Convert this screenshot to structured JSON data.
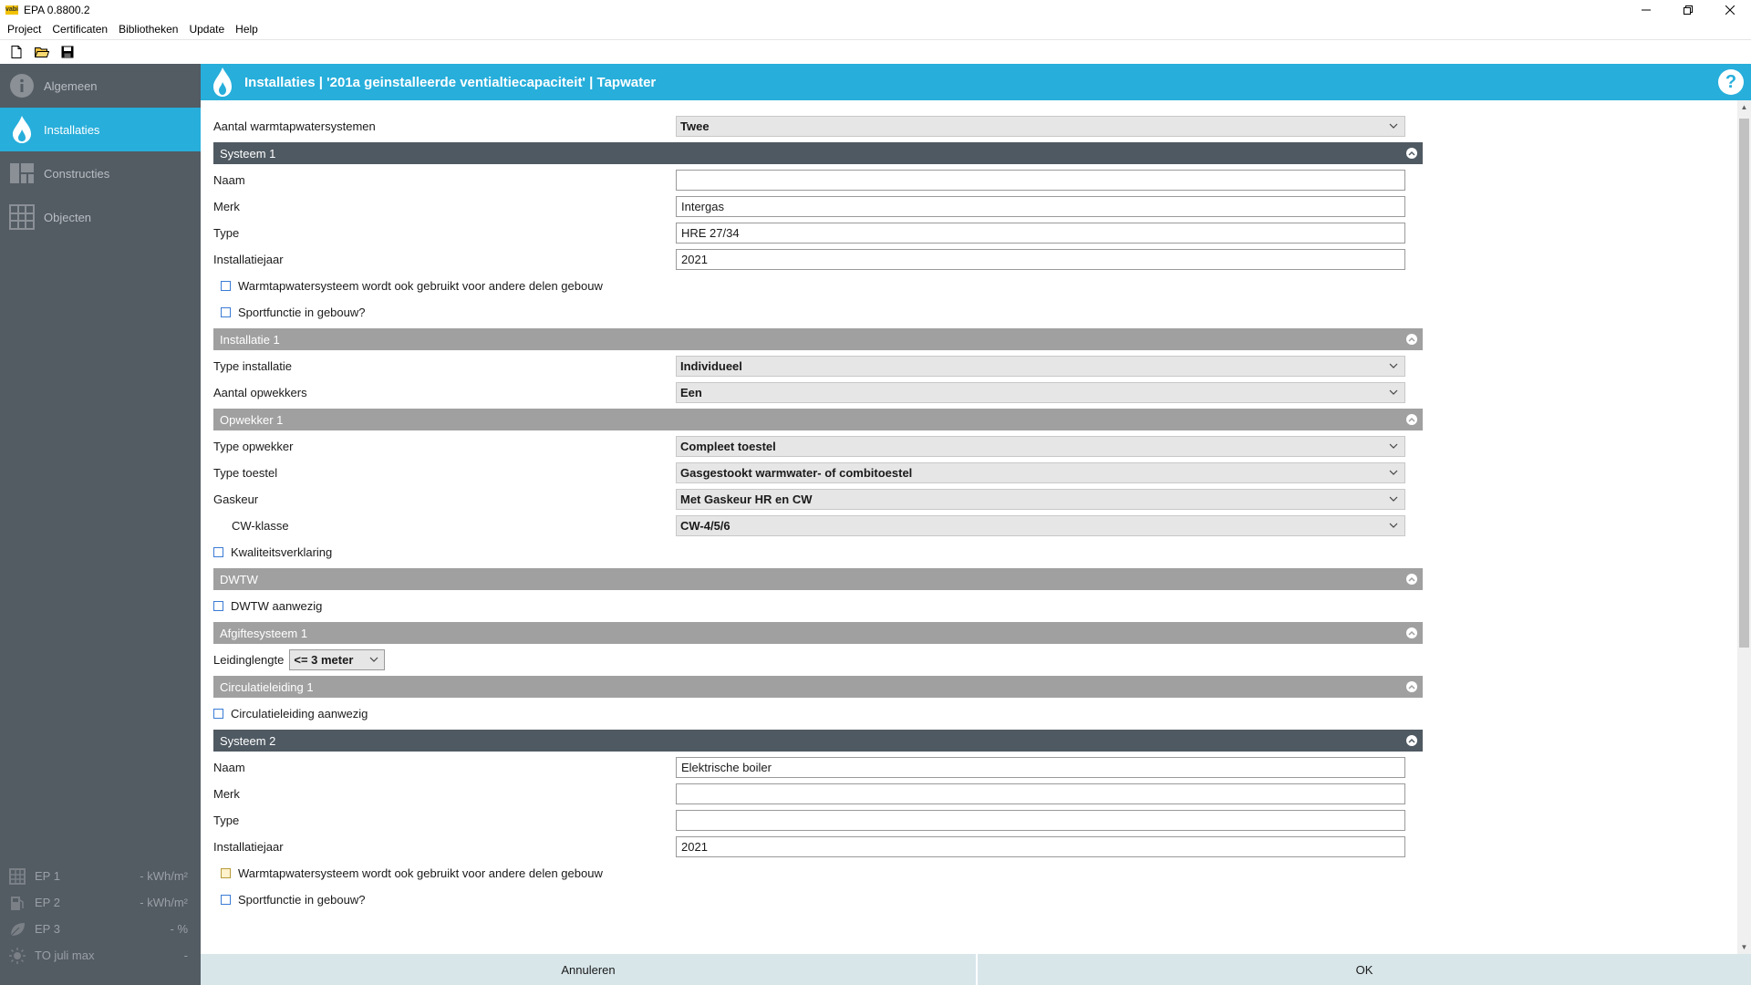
{
  "window": {
    "title": "EPA 0.8800.2",
    "app_badge": "vabi"
  },
  "menu": [
    "Project",
    "Certificaten",
    "Bibliotheken",
    "Update",
    "Help"
  ],
  "sidebar": {
    "items": [
      {
        "label": "Algemeen",
        "icon": "info-icon"
      },
      {
        "label": "Installaties",
        "icon": "flame-icon",
        "active": true
      },
      {
        "label": "Constructies",
        "icon": "blocks-icon"
      },
      {
        "label": "Objecten",
        "icon": "building-icon"
      }
    ],
    "stats": [
      {
        "label": "EP 1",
        "value": "- kWh/m²"
      },
      {
        "label": "EP 2",
        "value": "- kWh/m²"
      },
      {
        "label": "EP 3",
        "value": "- %"
      },
      {
        "label": "TO juli max",
        "value": "-"
      }
    ]
  },
  "header": {
    "title": "Installaties | '201a geinstalleerde ventialtiecapaciteit' | Tapwater",
    "help": "?"
  },
  "form": {
    "aantal": {
      "label": "Aantal warmtapwatersystemen",
      "value": "Twee"
    },
    "systeem1": {
      "title": "Systeem 1",
      "naam": {
        "label": "Naam",
        "value": ""
      },
      "merk": {
        "label": "Merk",
        "value": "Intergas"
      },
      "type": {
        "label": "Type",
        "value": "HRE 27/34"
      },
      "jaar": {
        "label": "Installatiejaar",
        "value": "2021"
      },
      "check_andere": "Warmtapwatersysteem wordt ook gebruikt voor andere delen gebouw",
      "check_sport": "Sportfunctie in gebouw?"
    },
    "installatie1": {
      "title": "Installatie 1",
      "type_installatie": {
        "label": "Type installatie",
        "value": "Individueel"
      },
      "aantal_opwekkers": {
        "label": "Aantal opwekkers",
        "value": "Een"
      }
    },
    "opwekker1": {
      "title": "Opwekker 1",
      "type_opwekker": {
        "label": "Type opwekker",
        "value": "Compleet toestel"
      },
      "type_toestel": {
        "label": "Type toestel",
        "value": "Gasgestookt warmwater- of combitoestel"
      },
      "gaskeur": {
        "label": "Gaskeur",
        "value": "Met Gaskeur HR en CW"
      },
      "cw_klasse": {
        "label": "CW-klasse",
        "value": "CW-4/5/6"
      },
      "check_kwaliteit": "Kwaliteitsverklaring"
    },
    "dwtw": {
      "title": "DWTW",
      "check": "DWTW aanwezig"
    },
    "afgifte1": {
      "title": "Afgiftesysteem 1",
      "label": "Leidinglengte",
      "value": "<= 3 meter"
    },
    "circulatie1": {
      "title": "Circulatieleiding 1",
      "check": "Circulatieleiding aanwezig"
    },
    "systeem2": {
      "title": "Systeem 2",
      "naam": {
        "label": "Naam",
        "value": "Elektrische boiler"
      },
      "merk": {
        "label": "Merk",
        "value": ""
      },
      "type": {
        "label": "Type",
        "value": ""
      },
      "jaar": {
        "label": "Installatiejaar",
        "value": "2021"
      },
      "check_andere": "Warmtapwatersysteem wordt ook gebruikt voor andere delen gebouw",
      "check_sport": "Sportfunctie in gebouw?"
    }
  },
  "footer": {
    "cancel": "Annuleren",
    "ok": "OK"
  },
  "colors": {
    "accent": "#27aedb",
    "sidebar": "#535b63",
    "section_dark": "#4f5962",
    "section_light": "#a0a0a0",
    "footer": "#d8e6ea"
  }
}
